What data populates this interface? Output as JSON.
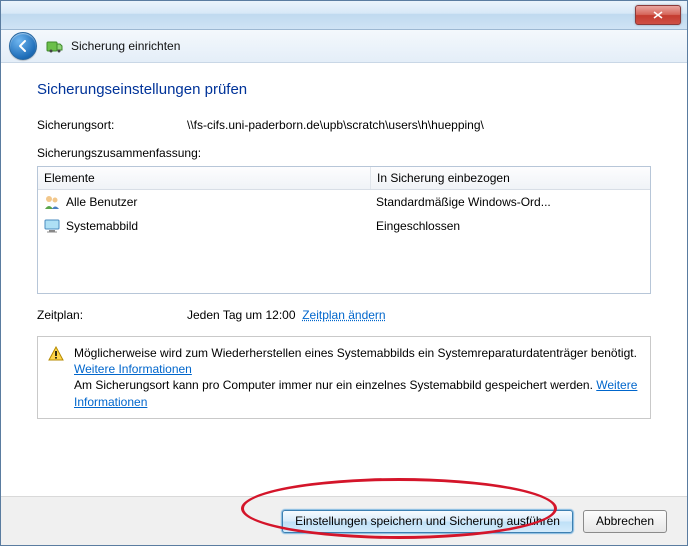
{
  "titlebar": {
    "close_icon": "close"
  },
  "nav": {
    "title": "Sicherung einrichten"
  },
  "heading": "Sicherungseinstellungen prüfen",
  "location": {
    "label": "Sicherungsort:",
    "value": "\\\\fs-cifs.uni-paderborn.de\\upb\\scratch\\users\\h\\huepping\\"
  },
  "summary_label": "Sicherungszusammenfassung:",
  "table": {
    "col1": "Elemente",
    "col2": "In Sicherung einbezogen",
    "rows": [
      {
        "name": "Alle Benutzer",
        "included": "Standardmäßige Windows-Ord...",
        "icon": "users"
      },
      {
        "name": "Systemabbild",
        "included": "Eingeschlossen",
        "icon": "monitor"
      }
    ]
  },
  "schedule": {
    "label": "Zeitplan:",
    "value": "Jeden Tag um 12:00",
    "change": "Zeitplan ändern"
  },
  "warning": {
    "line1a": "Möglicherweise wird zum Wiederherstellen eines Systemabbilds ein Systemreparaturdatenträger benötigt. ",
    "link1": "Weitere Informationen",
    "line2a": "Am Sicherungsort kann pro Computer immer nur ein einzelnes Systemabbild gespeichert werden. ",
    "link2": "Weitere Informationen"
  },
  "footer": {
    "primary": "Einstellungen speichern und Sicherung ausführen",
    "cancel": "Abbrechen"
  }
}
